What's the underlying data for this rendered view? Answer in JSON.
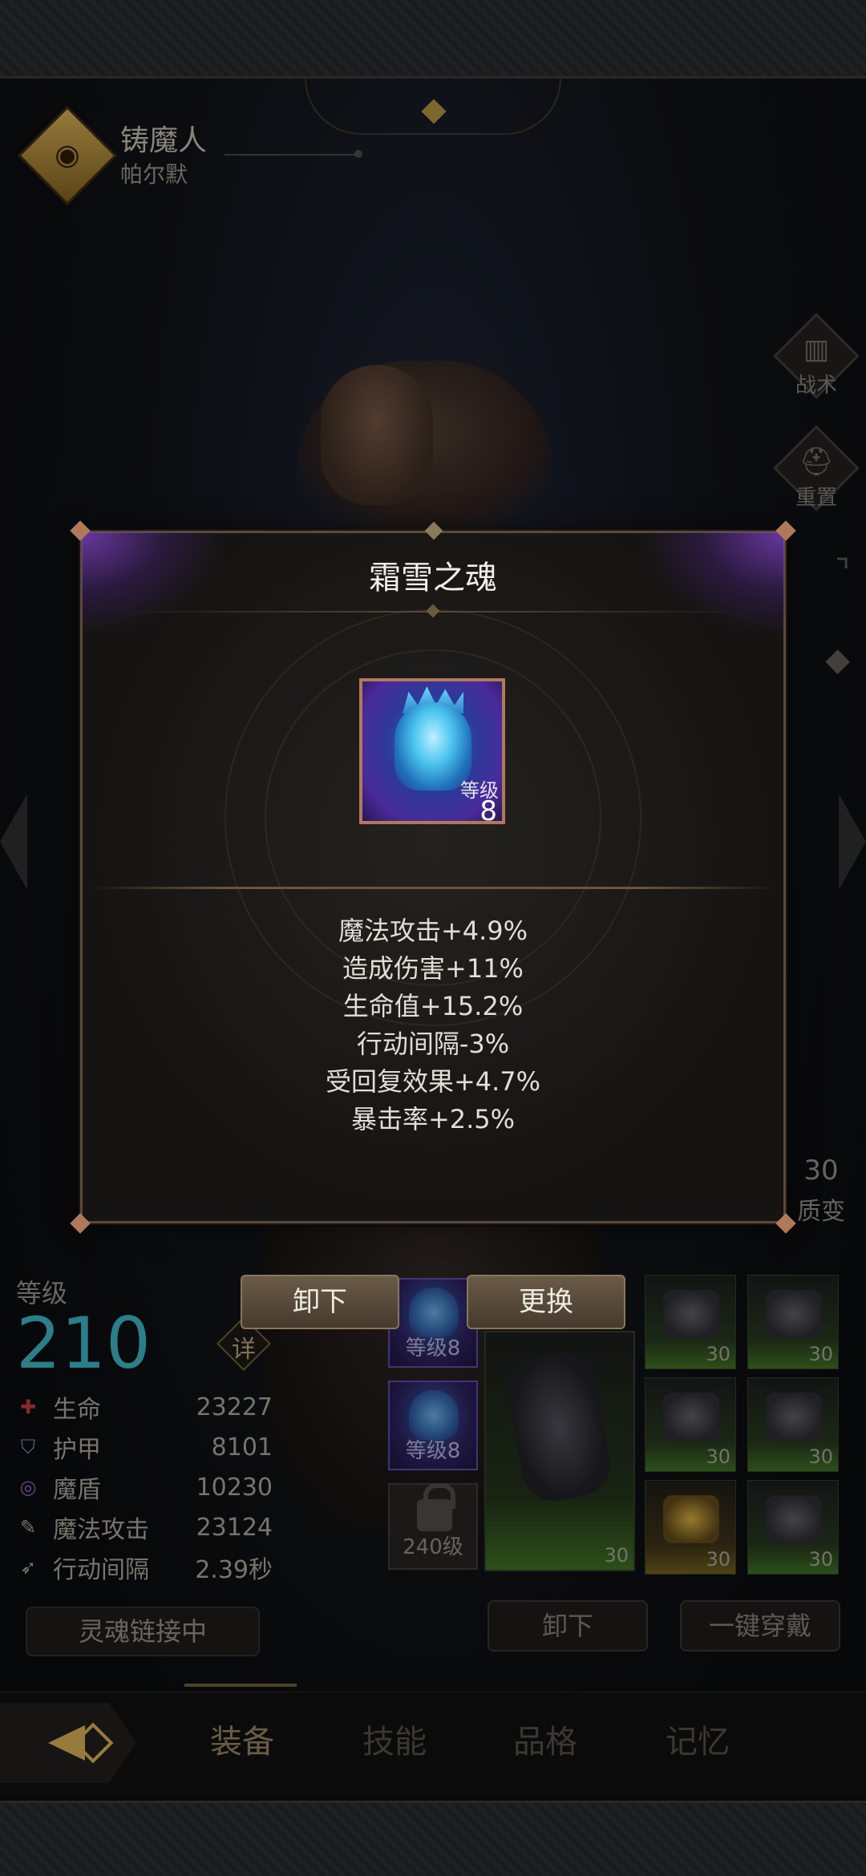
{
  "hero": {
    "class_name": "铸魔人",
    "hero_name": "帕尔默"
  },
  "side_buttons": [
    {
      "label": "战术",
      "icon": "banner-icon"
    },
    {
      "label": "重置",
      "icon": "helmet-icon"
    }
  ],
  "evolve": {
    "number": "30",
    "label": "质变"
  },
  "level": {
    "label": "等级",
    "value": "210",
    "detail_label": "详"
  },
  "stats": [
    {
      "name": "生命",
      "value": "23227",
      "icon": "health-icon",
      "color": "#b23a3a"
    },
    {
      "name": "护甲",
      "value": "8101",
      "icon": "armor-icon",
      "color": "#6e8ab8"
    },
    {
      "name": "魔盾",
      "value": "10230",
      "icon": "magic-shield-icon",
      "color": "#8a5ac0"
    },
    {
      "name": "魔法攻击",
      "value": "23124",
      "icon": "magic-attack-icon",
      "color": "#a09b91"
    },
    {
      "name": "行动间隔",
      "value": "2.39秒",
      "icon": "action-interval-icon",
      "color": "#a09b91"
    }
  ],
  "soul_link_label": "灵魂链接中",
  "soul_slots": [
    {
      "level_text": "等级8"
    },
    {
      "level_text": "等级8"
    }
  ],
  "locked_slot": {
    "level_text": "240级"
  },
  "main_gear": {
    "level": "30"
  },
  "gear_cells": [
    {
      "level": "30",
      "icon": "helmet-gear-icon"
    },
    {
      "level": "30",
      "icon": "shoulder-gear-icon"
    },
    {
      "level": "30",
      "icon": "gauntlet-gear-icon"
    },
    {
      "level": "30",
      "icon": "bracer-gear-icon"
    },
    {
      "level": "30",
      "icon": "amulet-gear-icon"
    },
    {
      "level": "30",
      "icon": "boots-gear-icon"
    }
  ],
  "bottom_buttons": {
    "unequip_all": "卸下",
    "equip_all": "一键穿戴"
  },
  "tabs": [
    {
      "label": "装备",
      "active": true
    },
    {
      "label": "技能",
      "active": false
    },
    {
      "label": "品格",
      "active": false
    },
    {
      "label": "记忆",
      "active": false
    }
  ],
  "modal": {
    "title": "霜雪之魂",
    "item_level_label": "等级",
    "item_level": "8",
    "attributes": [
      "魔法攻击+4.9%",
      "造成伤害+11%",
      "生命值+15.2%",
      "行动间隔-3%",
      "受回复效果+4.7%",
      "暴击率+2.5%"
    ],
    "unequip_label": "卸下",
    "replace_label": "更换"
  },
  "colors": {
    "level_value": "#3aa9b8",
    "modal_glow": "#8c46dc",
    "frame_border": "#b07a5a",
    "active_tab": "#8d7c58"
  }
}
